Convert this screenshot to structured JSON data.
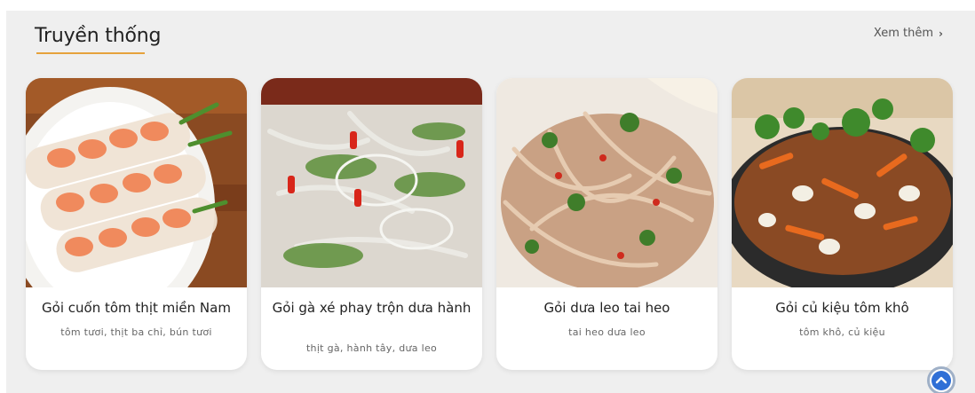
{
  "section": {
    "title": "Truyền thống",
    "more_label": "Xem thêm",
    "accent_color": "#e6a23c"
  },
  "cards": [
    {
      "name": "Gỏi cuốn tôm thịt miền Nam",
      "ingredients": "tôm tươi, thịt ba chỉ, bún tươi"
    },
    {
      "name": "Gỏi gà xé phay trộn dưa hành",
      "ingredients": "thịt gà, hành tây, dưa leo"
    },
    {
      "name": "Gỏi dưa leo tai heo",
      "ingredients": "tai heo dưa leo"
    },
    {
      "name": "Gỏi củ kiệu tôm khô",
      "ingredients": "tôm khô, củ kiệu"
    }
  ],
  "icons": {
    "more": "chevron-right-icon",
    "scroll": "scroll-to-top-icon"
  }
}
